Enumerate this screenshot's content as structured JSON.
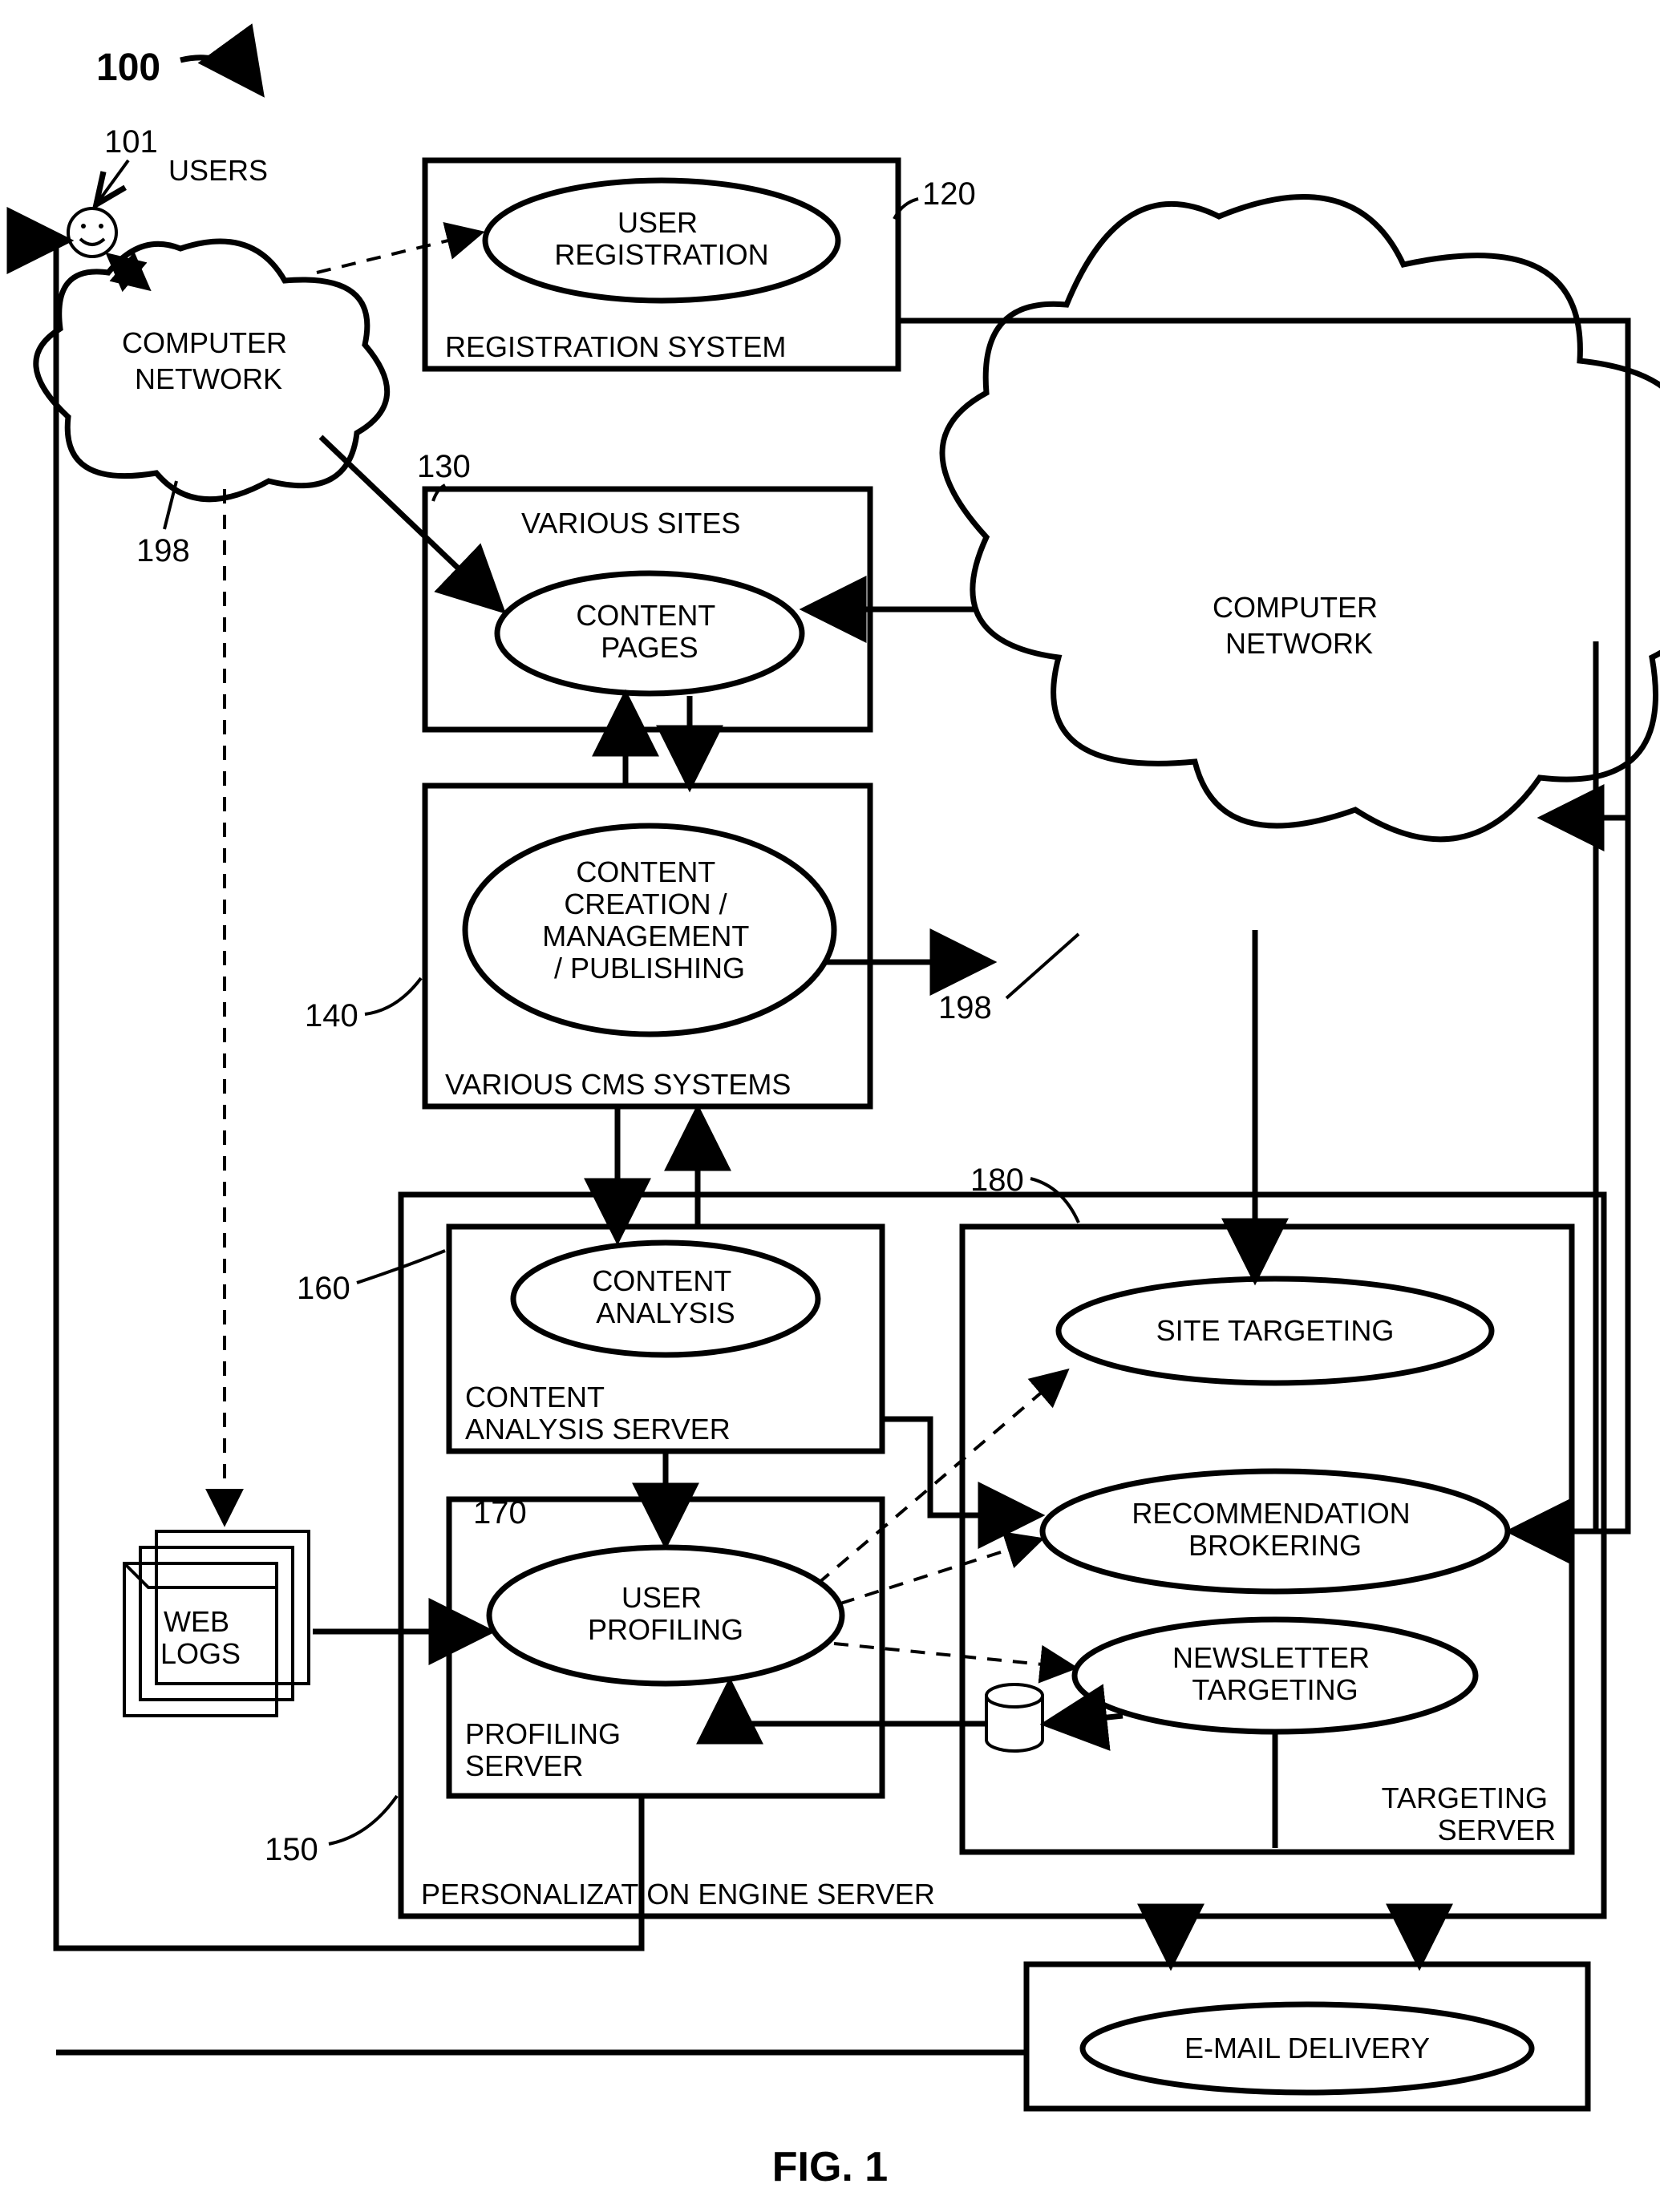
{
  "figure": {
    "title_ref": "100",
    "caption": "FIG. 1"
  },
  "refs": {
    "users": "101",
    "users_label": "USERS",
    "net1": "198",
    "net2": "198",
    "reg": "120",
    "sites": "130",
    "cms": "140",
    "pers": "150",
    "cas": "160",
    "prof": "170",
    "targ": "180"
  },
  "labels": {
    "computer_network_1": "COMPUTER\nNETWORK",
    "computer_network_2": "COMPUTER\nNETWORK",
    "registration_system": "REGISTRATION SYSTEM",
    "user_registration": "USER\nREGISTRATION",
    "various_sites": "VARIOUS SITES",
    "content_pages": "CONTENT\nPAGES",
    "various_cms": "VARIOUS CMS SYSTEMS",
    "cms_ellipse": "CONTENT\nCREATION /\nMANAGEMENT\n/ PUBLISHING",
    "personalization_engine": "PERSONALIZATION ENGINE SERVER",
    "content_analysis_server": "CONTENT\nANALYSIS SERVER",
    "content_analysis": "CONTENT\nANALYSIS",
    "profiling_server": "PROFILING\nSERVER",
    "user_profiling": "USER\nPROFILING",
    "targeting_server": "TARGETING\nSERVER",
    "site_targeting": "SITE TARGETING",
    "recommendation_brokering": "RECOMMENDATION\nBROKERING",
    "newsletter_targeting": "NEWSLETTER\nTARGETING",
    "email_delivery": "E-MAIL DELIVERY",
    "web_logs": "WEB\nLOGS"
  }
}
